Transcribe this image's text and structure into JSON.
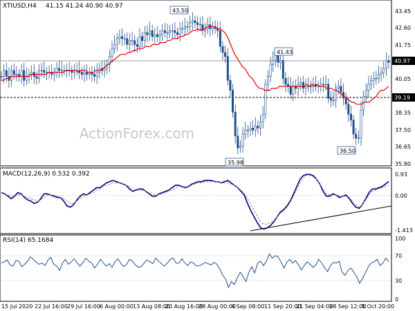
{
  "chart_data": {
    "type": "line",
    "symbol_label": "XTIUSD,H4",
    "ohlc_label": "41.15 41.24 40.90 40.97",
    "watermark": "ActionForex.com",
    "x_tick_labels": [
      "15 Jul 2020",
      "22 Jul 16:00",
      "29 Jul 16:00",
      "6 Aug 00:00",
      "13 Aug 08:00",
      "20 Aug 16:00",
      "28 Aug 00:00",
      "4 Sep 08:00",
      "11 Sep 20:00",
      "21 Sep 04:00",
      "28 Sep 12:00",
      "5 Oct 20:00"
    ],
    "panels": [
      {
        "id": "price",
        "y_tick_labels": [
          "43.45",
          "42.60",
          "41.75",
          "40.95",
          "40.05",
          "39.20",
          "38.35",
          "37.50",
          "36.65",
          "35.80"
        ],
        "ylim": [
          35.8,
          44.0
        ],
        "current_price": "40.97",
        "level_label": "39.19",
        "annotations": [
          "43.50",
          "41.43",
          "35.98",
          "36.50"
        ],
        "series": [
          {
            "values": [
              40.3,
              40.6,
              40.3,
              40.1,
              40.6,
              40.4,
              40.4,
              40.3,
              40.6,
              40.1,
              40.3,
              40.4,
              40.5,
              40.3,
              40.2,
              40.6,
              40.6,
              40.5,
              40.5,
              40.5,
              40.4,
              40.5,
              40.7,
              40.6,
              40.6,
              40.6,
              40.6,
              40.6,
              40.5,
              40.6,
              40.6,
              40.5,
              40.4,
              40.5,
              40.4,
              40.5,
              40.4,
              40.3,
              40.5,
              40.7,
              40.6,
              40.7,
              40.9,
              41.3,
              41.7,
              41.9,
              42.2,
              42.3,
              42.2,
              42.2,
              41.9,
              42.1,
              42.1,
              41.9,
              41.8,
              42.3,
              42.1,
              42.5,
              42.4,
              42.6,
              42.3,
              42.4,
              42.3,
              42.4,
              42.6,
              42.5,
              42.5,
              42.6,
              42.6,
              42.5,
              42.4,
              42.7,
              42.7,
              42.8,
              42.8,
              43.0,
              43.1,
              43.0,
              42.9,
              42.9,
              42.6,
              42.7,
              42.9,
              42.7,
              42.8,
              42.7,
              42.6,
              41.8,
              41.5,
              41.3,
              40.1,
              39.6,
              38.5,
              37.3,
              36.7,
              36.8,
              37.4,
              37.6,
              37.6,
              37.7,
              37.6,
              37.8,
              37.7,
              38.0,
              38.4,
              39.9,
              40.3,
              40.9,
              41.1,
              41.4,
              41.0,
              41.1,
              40.2,
              39.9,
              39.8,
              39.4,
              39.8,
              39.7,
              39.9,
              40.0,
              39.7,
              39.8,
              39.8,
              39.8,
              39.9,
              39.8,
              39.8,
              39.9,
              39.9,
              39.9,
              39.2,
              39.1,
              39.1,
              39.7,
              39.8,
              39.5,
              39.2,
              38.9,
              38.4,
              38.1,
              37.4,
              37.2,
              37.2,
              38.6,
              39.3,
              39.6,
              39.9,
              40.1,
              40.2,
              40.2,
              40.4,
              40.5,
              40.7,
              41.1,
              41.0
            ]
          },
          {
            "values": [
              40.1,
              40.1,
              40.2,
              40.2,
              40.3,
              40.3,
              40.3,
              40.3,
              40.3,
              40.3,
              40.3,
              40.3,
              40.4,
              40.4,
              40.4,
              40.4,
              40.4,
              40.4,
              40.4,
              40.5,
              40.5,
              40.5,
              40.5,
              40.5,
              40.5,
              40.5,
              40.6,
              40.6,
              40.6,
              40.6,
              40.6,
              40.5,
              40.6,
              40.6,
              40.6,
              40.5,
              40.5,
              40.5,
              40.6,
              40.6,
              40.6,
              40.7,
              40.8,
              40.9,
              41.0,
              41.1,
              41.2,
              41.3,
              41.4,
              41.4,
              41.4,
              41.5,
              41.5,
              41.6,
              41.6,
              41.7,
              41.7,
              41.7,
              41.8,
              41.8,
              41.8,
              41.9,
              41.9,
              41.9,
              42.0,
              42.0,
              42.0,
              42.1,
              42.1,
              42.2,
              42.2,
              42.2,
              42.3,
              42.3,
              42.4,
              42.4,
              42.5,
              42.6,
              42.6,
              42.7,
              42.6,
              42.7,
              42.7,
              42.8,
              42.8,
              42.8,
              42.8,
              42.7,
              42.7,
              42.6,
              42.5,
              42.3,
              42.0,
              41.7,
              41.4,
              41.2,
              41.0,
              40.8,
              40.7,
              40.5,
              40.3,
              40.2,
              40.0,
              39.8,
              39.7,
              39.7,
              39.6,
              39.6,
              39.6,
              39.7,
              39.7,
              39.7,
              39.8,
              39.8,
              39.8,
              39.8,
              39.8,
              39.8,
              39.8,
              39.8,
              39.8,
              39.8,
              39.8,
              39.9,
              39.8,
              39.9,
              39.8,
              39.9,
              39.8,
              39.8,
              39.8,
              39.7,
              39.7,
              39.7,
              39.6,
              39.6,
              39.5,
              39.4,
              39.3,
              39.2,
              39.1,
              39.0,
              39.0,
              38.9,
              38.9,
              38.9,
              39.0,
              39.0,
              39.0,
              39.1,
              39.2,
              39.3,
              39.5,
              39.6,
              39.6,
              39.7,
              39.8
            ]
          }
        ]
      },
      {
        "id": "macd",
        "label": "MACD(12,26,9) 0.532 0.392",
        "y_tick_labels": [
          "0.93",
          "0.00",
          "-1.413"
        ],
        "ylim": [
          -1.48,
          1.05
        ],
        "series": [
          {
            "values": [
              0.15,
              0.1,
              0.0,
              -0.1,
              0.0,
              0.15,
              0.1,
              -0.05,
              -0.15,
              -0.2,
              -0.3,
              -0.25,
              -0.1,
              0.1,
              0.1,
              0.05,
              0.0,
              -0.05,
              -0.05,
              -0.2,
              -0.4,
              -0.45,
              -0.35,
              -0.15,
              0.0,
              0.1,
              0.05,
              0.15,
              0.25,
              0.35,
              0.35,
              0.45,
              0.55,
              0.6,
              0.65,
              0.6,
              0.55,
              0.5,
              0.45,
              0.3,
              0.2,
              0.25,
              0.3,
              0.3,
              0.2,
              0.1,
              0.0,
              0.0,
              0.1,
              0.15,
              0.2,
              0.25,
              0.35,
              0.45,
              0.45,
              0.4,
              0.35,
              0.4,
              0.5,
              0.55,
              0.6,
              0.6,
              0.65,
              0.65,
              0.65,
              0.6,
              0.6,
              0.55,
              0.6,
              0.65,
              0.55,
              0.45,
              0.35,
              0.2,
              0.05,
              -0.3,
              -0.6,
              -0.85,
              -1.1,
              -1.3,
              -1.35,
              -1.3,
              -1.2,
              -1.05,
              -0.85,
              -0.65,
              -0.55,
              -0.4,
              -0.2,
              0.1,
              0.4,
              0.7,
              0.85,
              0.9,
              0.9,
              0.85,
              0.7,
              0.5,
              0.2,
              -0.0,
              0.0,
              0.1,
              0.05,
              -0.05,
              0.0,
              0.05,
              -0.1,
              -0.3,
              -0.45,
              -0.5,
              -0.35,
              -0.1,
              0.15,
              0.3,
              0.3,
              0.35,
              0.4,
              0.5,
              0.6
            ]
          },
          {
            "values": [
              0.12,
              0.1,
              0.05,
              0.0,
              0.0,
              0.05,
              0.05,
              0.0,
              -0.05,
              -0.1,
              -0.15,
              -0.2,
              -0.15,
              -0.05,
              0.05,
              0.05,
              0.05,
              0.0,
              -0.05,
              -0.1,
              -0.2,
              -0.3,
              -0.3,
              -0.2,
              -0.1,
              0.0,
              0.05,
              0.1,
              0.15,
              0.25,
              0.3,
              0.4,
              0.45,
              0.5,
              0.55,
              0.55,
              0.55,
              0.5,
              0.45,
              0.4,
              0.3,
              0.25,
              0.25,
              0.25,
              0.2,
              0.15,
              0.1,
              0.05,
              0.05,
              0.1,
              0.15,
              0.2,
              0.25,
              0.35,
              0.4,
              0.4,
              0.4,
              0.4,
              0.45,
              0.5,
              0.55,
              0.55,
              0.6,
              0.6,
              0.6,
              0.6,
              0.6,
              0.55,
              0.55,
              0.55,
              0.5,
              0.45,
              0.35,
              0.25,
              0.1,
              -0.1,
              -0.35,
              -0.6,
              -0.85,
              -1.05,
              -1.15,
              -1.15,
              -1.1,
              -1.0,
              -0.85,
              -0.7,
              -0.6,
              -0.45,
              -0.25,
              0.0,
              0.25,
              0.55,
              0.75,
              0.85,
              0.85,
              0.8,
              0.7,
              0.5,
              0.3,
              0.1,
              0.05,
              0.05,
              0.05,
              0.0,
              0.0,
              0.0,
              -0.05,
              -0.2,
              -0.35,
              -0.45,
              -0.35,
              -0.15,
              0.05,
              0.2,
              0.25,
              0.3,
              0.35,
              0.4,
              0.45
            ]
          }
        ]
      },
      {
        "id": "rsi",
        "label": "RSI(14) 65.1684",
        "y_tick_labels": [
          "100",
          "70",
          "30",
          "0"
        ],
        "ylim": [
          0,
          100
        ],
        "series": [
          {
            "values": [
              60,
              62,
              65,
              57,
              55,
              64,
              63,
              54,
              58,
              63,
              70,
              66,
              61,
              58,
              60,
              56,
              65,
              69,
              58,
              55,
              48,
              60,
              66,
              58,
              62,
              67,
              60,
              55,
              61,
              68,
              63,
              60,
              52,
              58,
              66,
              60,
              55,
              59,
              53,
              62,
              67,
              60,
              54,
              58,
              66,
              63,
              57,
              53,
              54,
              60,
              65,
              62,
              59,
              68,
              63,
              59,
              55,
              60,
              66,
              68,
              60,
              60,
              67,
              60,
              56,
              62,
              60,
              55,
              56,
              58,
              61,
              59,
              57,
              61,
              58,
              50,
              40,
              34,
              20,
              30,
              25,
              36,
              45,
              38,
              30,
              45,
              54,
              44,
              60,
              63,
              56,
              63,
              75,
              68,
              72,
              70,
              62,
              52,
              61,
              66,
              60,
              64,
              57,
              49,
              56,
              62,
              58,
              53,
              57,
              66,
              60,
              52,
              46,
              56,
              61,
              60,
              63,
              45,
              40,
              48,
              52,
              45,
              38,
              27,
              35,
              44,
              54,
              60,
              62,
              66,
              56,
              60,
              68,
              62
            ]
          }
        ]
      }
    ]
  }
}
